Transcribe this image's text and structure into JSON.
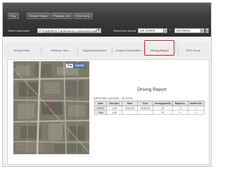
{
  "header": {
    "menu_tabs": [
      "Map",
      "Vehicle Status",
      "Program Info",
      "ECU Setup"
    ],
    "data_folder_label": "Select data folder",
    "data_folder_value": "F:\\USB\\2011 Car\\Driving Log\\Saved Data",
    "time_period_label": "Select time period",
    "date_from": "10/ 1/2000",
    "date_to": "6/17/2011",
    "range_separator": "~"
  },
  "tabs": {
    "items": [
      "Driving Diary",
      "Parking / Stop",
      "Rapid Acceleration",
      "Sudden Deceleration",
      "Driving Report",
      "ECO Score"
    ],
    "active": "Driving Report"
  },
  "map": {
    "map_button": "Map",
    "satellite_button": "Satellite"
  },
  "report": {
    "title": "Driving Report",
    "date_range_label": "DATE/TIME",
    "date_range_value": "10/1/2000 ~ 6/17/2011",
    "columns": [
      "Date",
      "Dist.(km)",
      "Start",
      "End",
      "Average(km/h)",
      "Rapid Ac.",
      "Sudden De."
    ],
    "rows": [
      [
        "6/15/11",
        "1.46",
        "15:40:53",
        "15:51:05",
        "12",
        "0",
        "1"
      ],
      [
        "Total",
        "1.46",
        "",
        "",
        "12",
        "0",
        "1"
      ]
    ]
  },
  "colors": {
    "top_bar": "#3c3c3c",
    "active_tab_highlight": "#d21d24"
  }
}
